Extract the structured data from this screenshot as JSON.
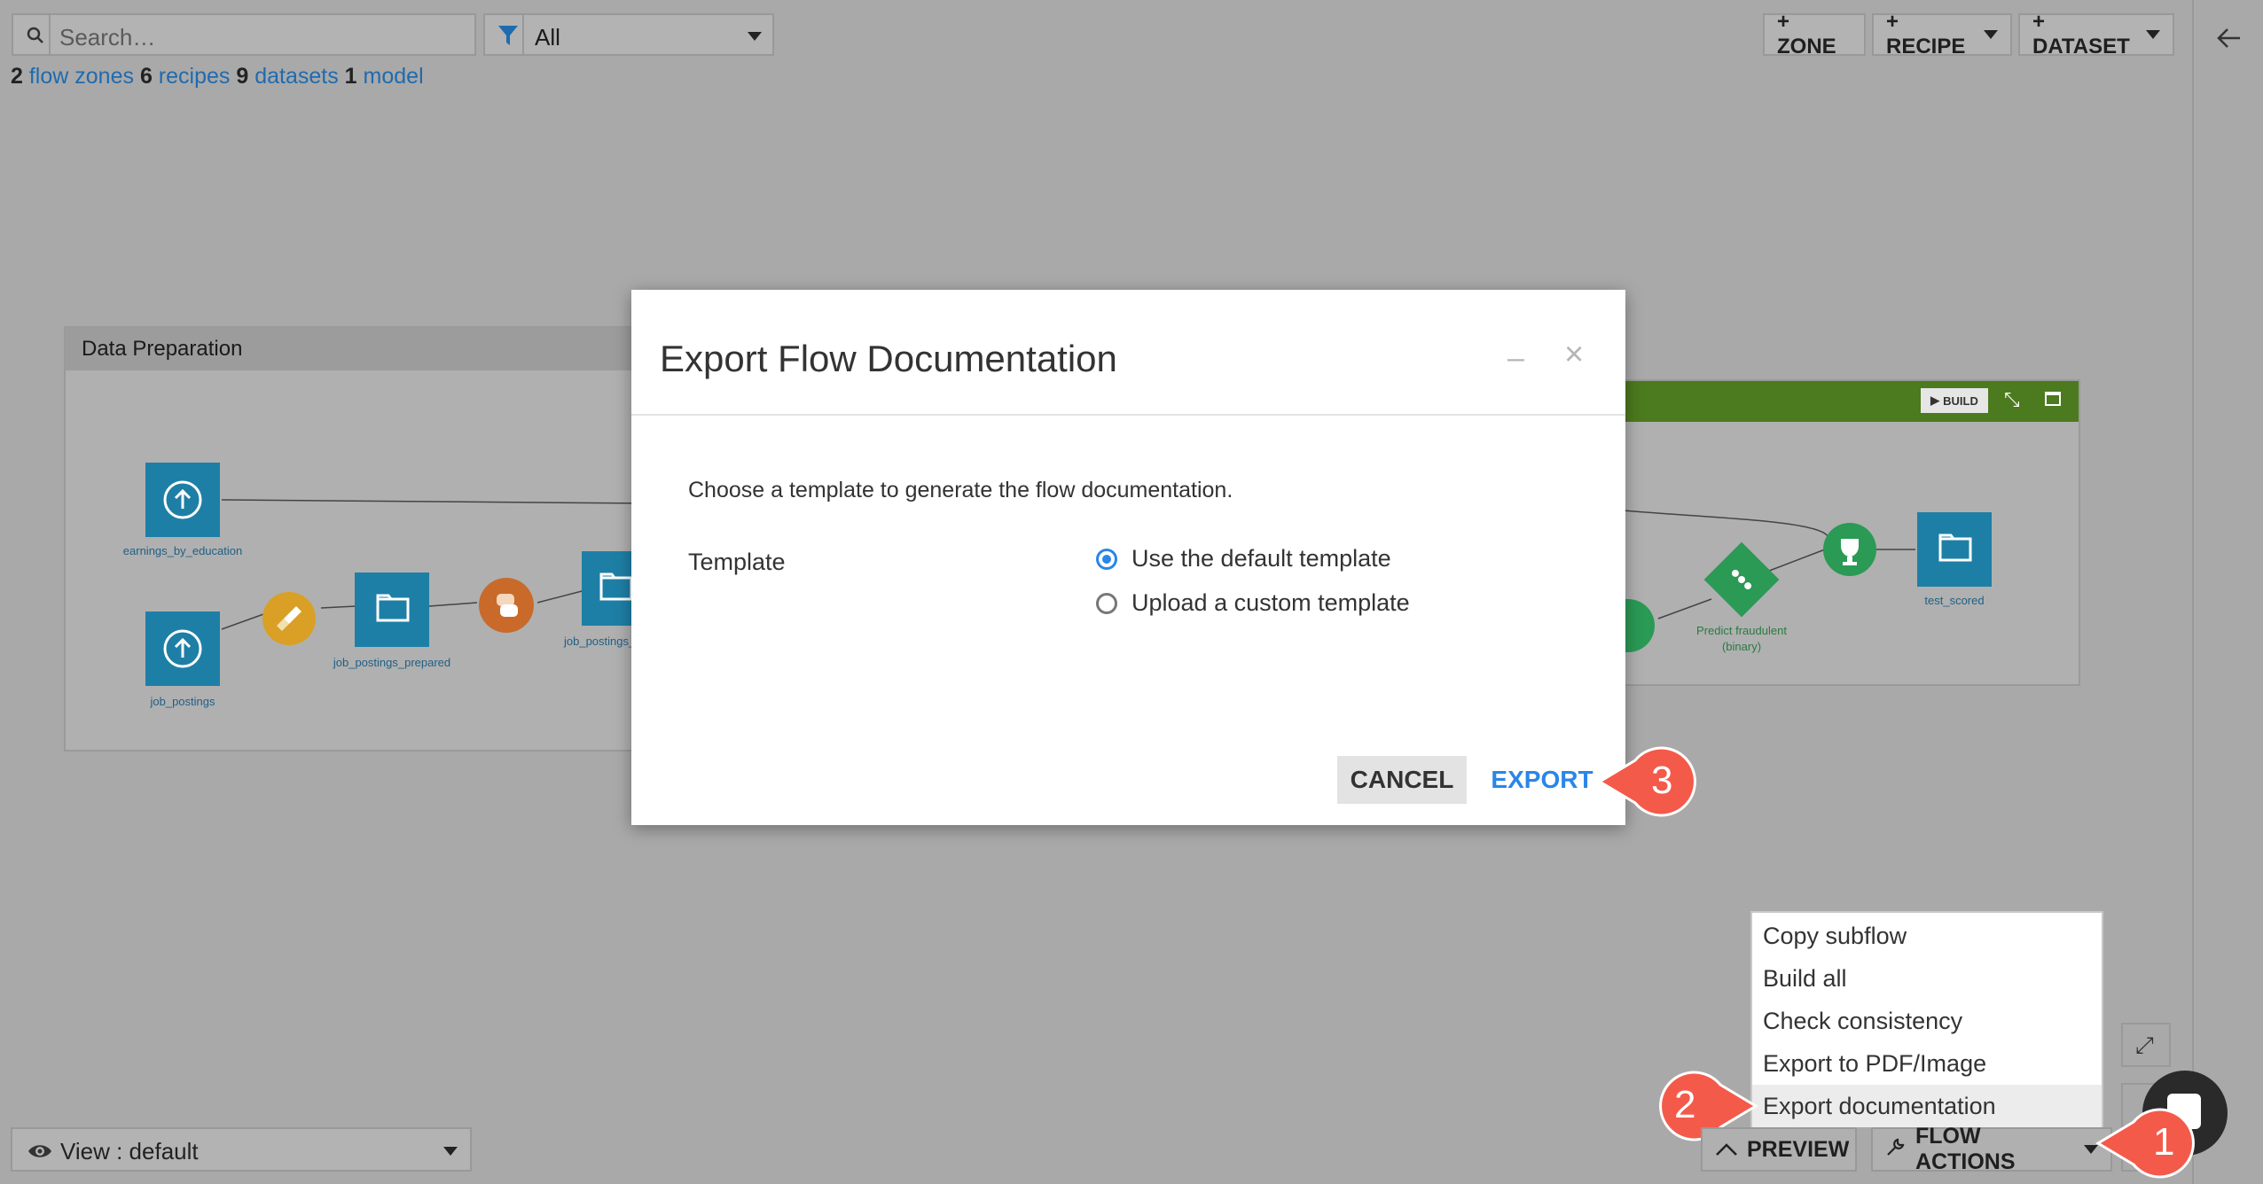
{
  "search": {
    "placeholder": "Search…"
  },
  "filter": {
    "value": "All"
  },
  "toolbar": {
    "zone": "+ ZONE",
    "recipe": "+ RECIPE",
    "dataset": "+ DATASET"
  },
  "counts": {
    "zones_n": "2",
    "zones": "flow zones",
    "recipes_n": "6",
    "recipes": "recipes",
    "datasets_n": "9",
    "datasets": "datasets",
    "model_n": "1",
    "model": "model"
  },
  "zone_left": {
    "title": "Data Preparation",
    "nodes": [
      "earnings_by_education",
      "job_postings",
      "job_postings_prepared",
      "job_postings_"
    ]
  },
  "zone_right": {
    "build": "BUILD",
    "nodes": [
      "Predict fraudulent",
      "(binary)",
      "test_scored"
    ]
  },
  "modal": {
    "title": "Export Flow Documentation",
    "description": "Choose a template to generate the flow documentation.",
    "template_label": "Template",
    "option_default": "Use the default template",
    "option_custom": "Upload a custom template",
    "cancel": "CANCEL",
    "export": "EXPORT"
  },
  "menu": {
    "items": [
      "Copy subflow",
      "Build all",
      "Check consistency",
      "Export to PDF/Image",
      "Export documentation"
    ]
  },
  "bottom": {
    "view": "View : default",
    "preview": "PREVIEW",
    "flow_actions": "FLOW ACTIONS"
  },
  "callouts": [
    "1",
    "2",
    "3"
  ],
  "colors": {
    "accent": "#2a86e8",
    "callout": "#f45a4a",
    "dataset": "#1e7fa6",
    "zone_green": "#4c7a1e"
  }
}
